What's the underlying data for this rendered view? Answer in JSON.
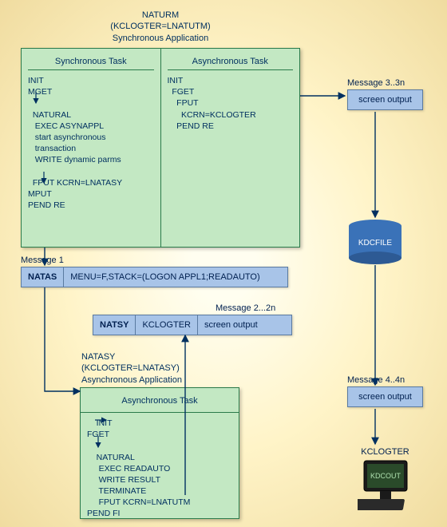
{
  "app_header": {
    "name": "NATURM",
    "kclogter": "(KCLOGTER=LNATUTM)",
    "type": "Synchronous Application"
  },
  "sync_app": {
    "sync_col_title": "Synchronous Task",
    "async_col_title": "Asynchronous Task",
    "sync_code": "INIT\nMGET\n\n  NATURAL\n   EXEC ASYNAPPL\n   start asynchronous\n   transaction\n   WRITE dynamic parms\n\n  FPUT KCRN=LNATASY\nMPUT\nPEND RE",
    "async_code": "INIT\n  FGET\n    FPUT\n      KCRN=KCLOGTER\n    PEND RE"
  },
  "msg1": {
    "label": "Message 1",
    "cell1": "NATAS",
    "cell2": "MENU=F,STACK=(LOGON APPL1;READAUTO)"
  },
  "msg2": {
    "label": "Message 2...2n",
    "cell1": "NATSY",
    "cell2": "KCLOGTER",
    "cell3": "screen output"
  },
  "async_app_header": {
    "name": "NATASY",
    "kclogter": "(KCLOGTER=LNATASY)",
    "type": "Asynchronous Application"
  },
  "async_app": {
    "title": "Asynchronous Task",
    "code": "    INIT\nFGET\n\n    NATURAL\n     EXEC READAUTO\n     WRITE RESULT\n     TERMINATE\n     FPUT KCRN=LNATUTM\nPEND FI"
  },
  "msg3": {
    "label": "Message 3..3n",
    "text": "screen output"
  },
  "msg4": {
    "label": "Message 4..4n",
    "text": "screen output"
  },
  "kdcfile": "KDCFILE",
  "computer": {
    "label": "KCLOGTER",
    "screen": "KDCOUT"
  }
}
